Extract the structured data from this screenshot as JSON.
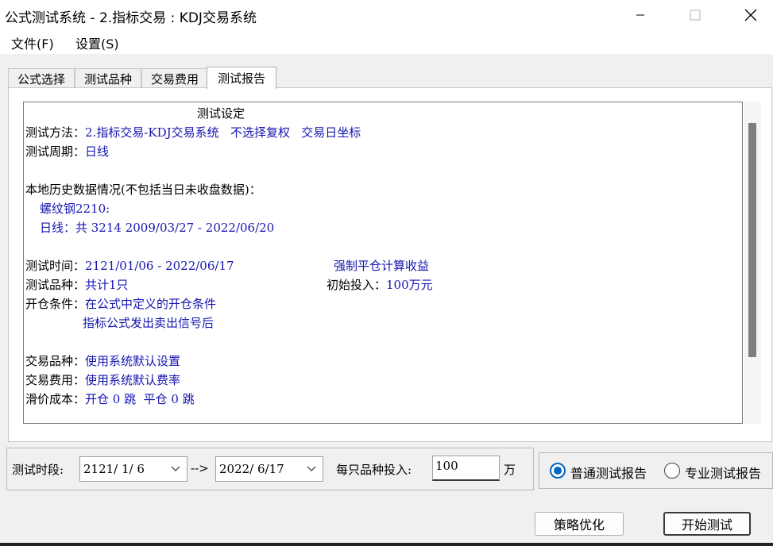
{
  "window": {
    "title": "公式测试系统 - 2.指标交易 : KDJ交易系统",
    "menu": [
      "文件(F)",
      "设置(S)"
    ]
  },
  "tabs": [
    "公式选择",
    "测试品种",
    "交易费用",
    "测试报告"
  ],
  "active_tab": "测试报告",
  "report": {
    "heading": "测试设定",
    "method_key": "测试方法：",
    "method_val": "2.指标交易-KDJ交易系统   不选择复权   交易日坐标",
    "period_key": "测试周期：",
    "period_val": "日线",
    "history_title": "本地历史数据情况(不包括当日未收盘数据)：",
    "history_symbol": "螺纹钢2210:",
    "history_detail": "日线：共 3214 2009/03/27 - 2022/06/20",
    "time_key": "测试时间：",
    "time_val": "2121/01/06 - 2022/06/17",
    "forced_close": "强制平仓计算收益",
    "varieties_key": "测试品种：",
    "varieties_val": "共计1只",
    "initial_key": "初始投入：",
    "initial_val": "100万元",
    "open_key": "开仓条件：",
    "open_val": "在公式中定义的开仓条件",
    "open_val2": "指标公式发出卖出信号后",
    "trade_var_key": "交易品种：",
    "trade_var_val": "使用系统默认设置",
    "trade_fee_key": "交易费用：",
    "trade_fee_val": "使用系统默认费率",
    "slip_key": "滑价成本：",
    "slip_val": "开仓 0 跳  平仓 0 跳"
  },
  "controls": {
    "period_label": "测试时段:",
    "start_date": "2121/ 1/ 6",
    "arrow": "-->",
    "end_date": "2022/ 6/17",
    "invest_label": "每只品种投入:",
    "invest_value": "100",
    "invest_unit": "万",
    "report_normal": "普通测试报告",
    "report_pro": "专业测试报告",
    "selected_report": "普通测试报告",
    "optimize_button": "策略优化",
    "start_button": "开始测试"
  },
  "colors": {
    "value_text": "#1515b0",
    "radio_accent": "#0067c0"
  }
}
